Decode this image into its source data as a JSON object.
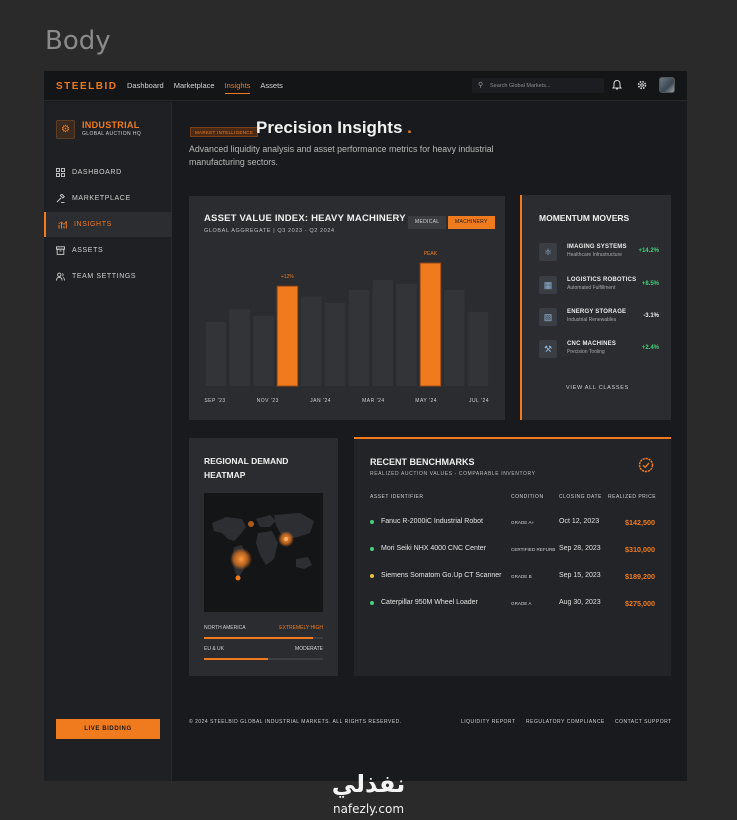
{
  "page_label": "Body",
  "topbar": {
    "brand": "STEELBID",
    "nav": [
      "Dashboard",
      "Marketplace",
      "Insights",
      "Assets"
    ],
    "search_placeholder": "Search Global Markets..."
  },
  "sidebar": {
    "logo_title": "INDUSTRIAL",
    "logo_sub": "GLOBAL AUCTION HQ",
    "items": [
      {
        "label": "DASHBOARD",
        "icon": "grid-icon"
      },
      {
        "label": "MARKETPLACE",
        "icon": "gavel-icon"
      },
      {
        "label": "INSIGHTS",
        "icon": "chart-icon"
      },
      {
        "label": "ASSETS",
        "icon": "archive-icon"
      },
      {
        "label": "TEAM SETTINGS",
        "icon": "team-icon"
      }
    ],
    "live_button": "LIVE BIDDING"
  },
  "header": {
    "tag": "MARKET INTELLIGENCE",
    "title": "Precision Insights",
    "title_dot": ".",
    "description": "Advanced liquidity analysis and asset performance metrics for heavy industrial manufacturing sectors."
  },
  "asset_index": {
    "title": "ASSET VALUE INDEX: HEAVY MACHINERY",
    "subtitle": "GLOBAL AGGREGATE | Q3 2023 - Q2 2024",
    "toggle_medical": "MEDICAL",
    "toggle_machinery": "MACHINERY"
  },
  "chart_data": {
    "type": "bar",
    "title": "ASSET VALUE INDEX: HEAVY MACHINERY",
    "categories": [
      "b1",
      "b2",
      "b3",
      "b4",
      "b5",
      "b6",
      "b7",
      "b8",
      "b9",
      "b10",
      "b11",
      "b12"
    ],
    "values": [
      50,
      60,
      55,
      78,
      70,
      65,
      75,
      83,
      80,
      96,
      75,
      58
    ],
    "highlighted": [
      3,
      9
    ],
    "annotations": [
      {
        "index": 3,
        "text": "+12%"
      },
      {
        "index": 9,
        "text": "PEAK"
      }
    ],
    "x_tick_labels": [
      "SEP '23",
      "NOV '23",
      "JAN '24",
      "MAR '24",
      "MAY '24",
      "JUL '24"
    ],
    "ylim": [
      0,
      100
    ],
    "colors": {
      "muted": "#323438",
      "highlight": "#f07b1f",
      "outline": "#a04a14"
    }
  },
  "momentum": {
    "title": "MOMENTUM MOVERS",
    "rows": [
      {
        "name": "IMAGING SYSTEMS",
        "category": "Healthcare Infrastructure",
        "change": "+14.2%",
        "trend": "up",
        "icon": "microscope-icon"
      },
      {
        "name": "LOGISTICS ROBOTICS",
        "category": "Automated Fulfillment",
        "change": "+8.5%",
        "trend": "up",
        "icon": "robot-icon"
      },
      {
        "name": "ENERGY STORAGE",
        "category": "Industrial Renewables",
        "change": "-3.1%",
        "trend": "down",
        "icon": "solar-icon"
      },
      {
        "name": "CNC MACHINES",
        "category": "Precision Tooling",
        "change": "+2.4%",
        "trend": "up",
        "icon": "tools-icon"
      }
    ],
    "link": "VIEW ALL CLASSES"
  },
  "heatmap": {
    "title": "REGIONAL DEMAND HEATMAP",
    "regions": [
      {
        "name": "NORTH AMERICA",
        "status": "EXTREMELY HIGH",
        "level": 0.92
      },
      {
        "name": "EU & UK",
        "status": "MODERATE",
        "level": 0.54
      }
    ]
  },
  "benchmarks": {
    "title": "RECENT BENCHMARKS",
    "subtitle": "REALIZED AUCTION VALUES - COMPARABLE INVENTORY",
    "columns": [
      "ASSET IDENTIFIER",
      "CONDITION",
      "CLOSING DATE",
      "REALIZED PRICE"
    ],
    "rows": [
      {
        "asset": "Fanuc R-2000iC Industrial Robot",
        "condition": "GRADE A+",
        "date": "Oct 12, 2023",
        "price": "$142,500",
        "dot": "#46d07a"
      },
      {
        "asset": "Mori Seiki NHX 4000 CNC Center",
        "condition": "CERTIFIED REFURB",
        "date": "Sep 28, 2023",
        "price": "$310,000",
        "dot": "#46d07a"
      },
      {
        "asset": "Siemens Somatom Go.Up CT Scanner",
        "condition": "GRADE B",
        "date": "Sep 15, 2023",
        "price": "$189,200",
        "dot": "#e8c23a"
      },
      {
        "asset": "Caterpillar 950M Wheel Loader",
        "condition": "GRADE A",
        "date": "Aug 30, 2023",
        "price": "$275,000",
        "dot": "#46d07a"
      }
    ]
  },
  "footer": {
    "copyright": "© 2024 STEELBID GLOBAL INDUSTRIAL MARKETS. ALL RIGHTS RESERVED.",
    "links": [
      "LIQUIDITY REPORT",
      "REGULATORY COMPLIANCE",
      "CONTACT SUPPORT"
    ]
  },
  "watermark": {
    "arabic": "نفذلي",
    "latin": "nafezly.com"
  }
}
